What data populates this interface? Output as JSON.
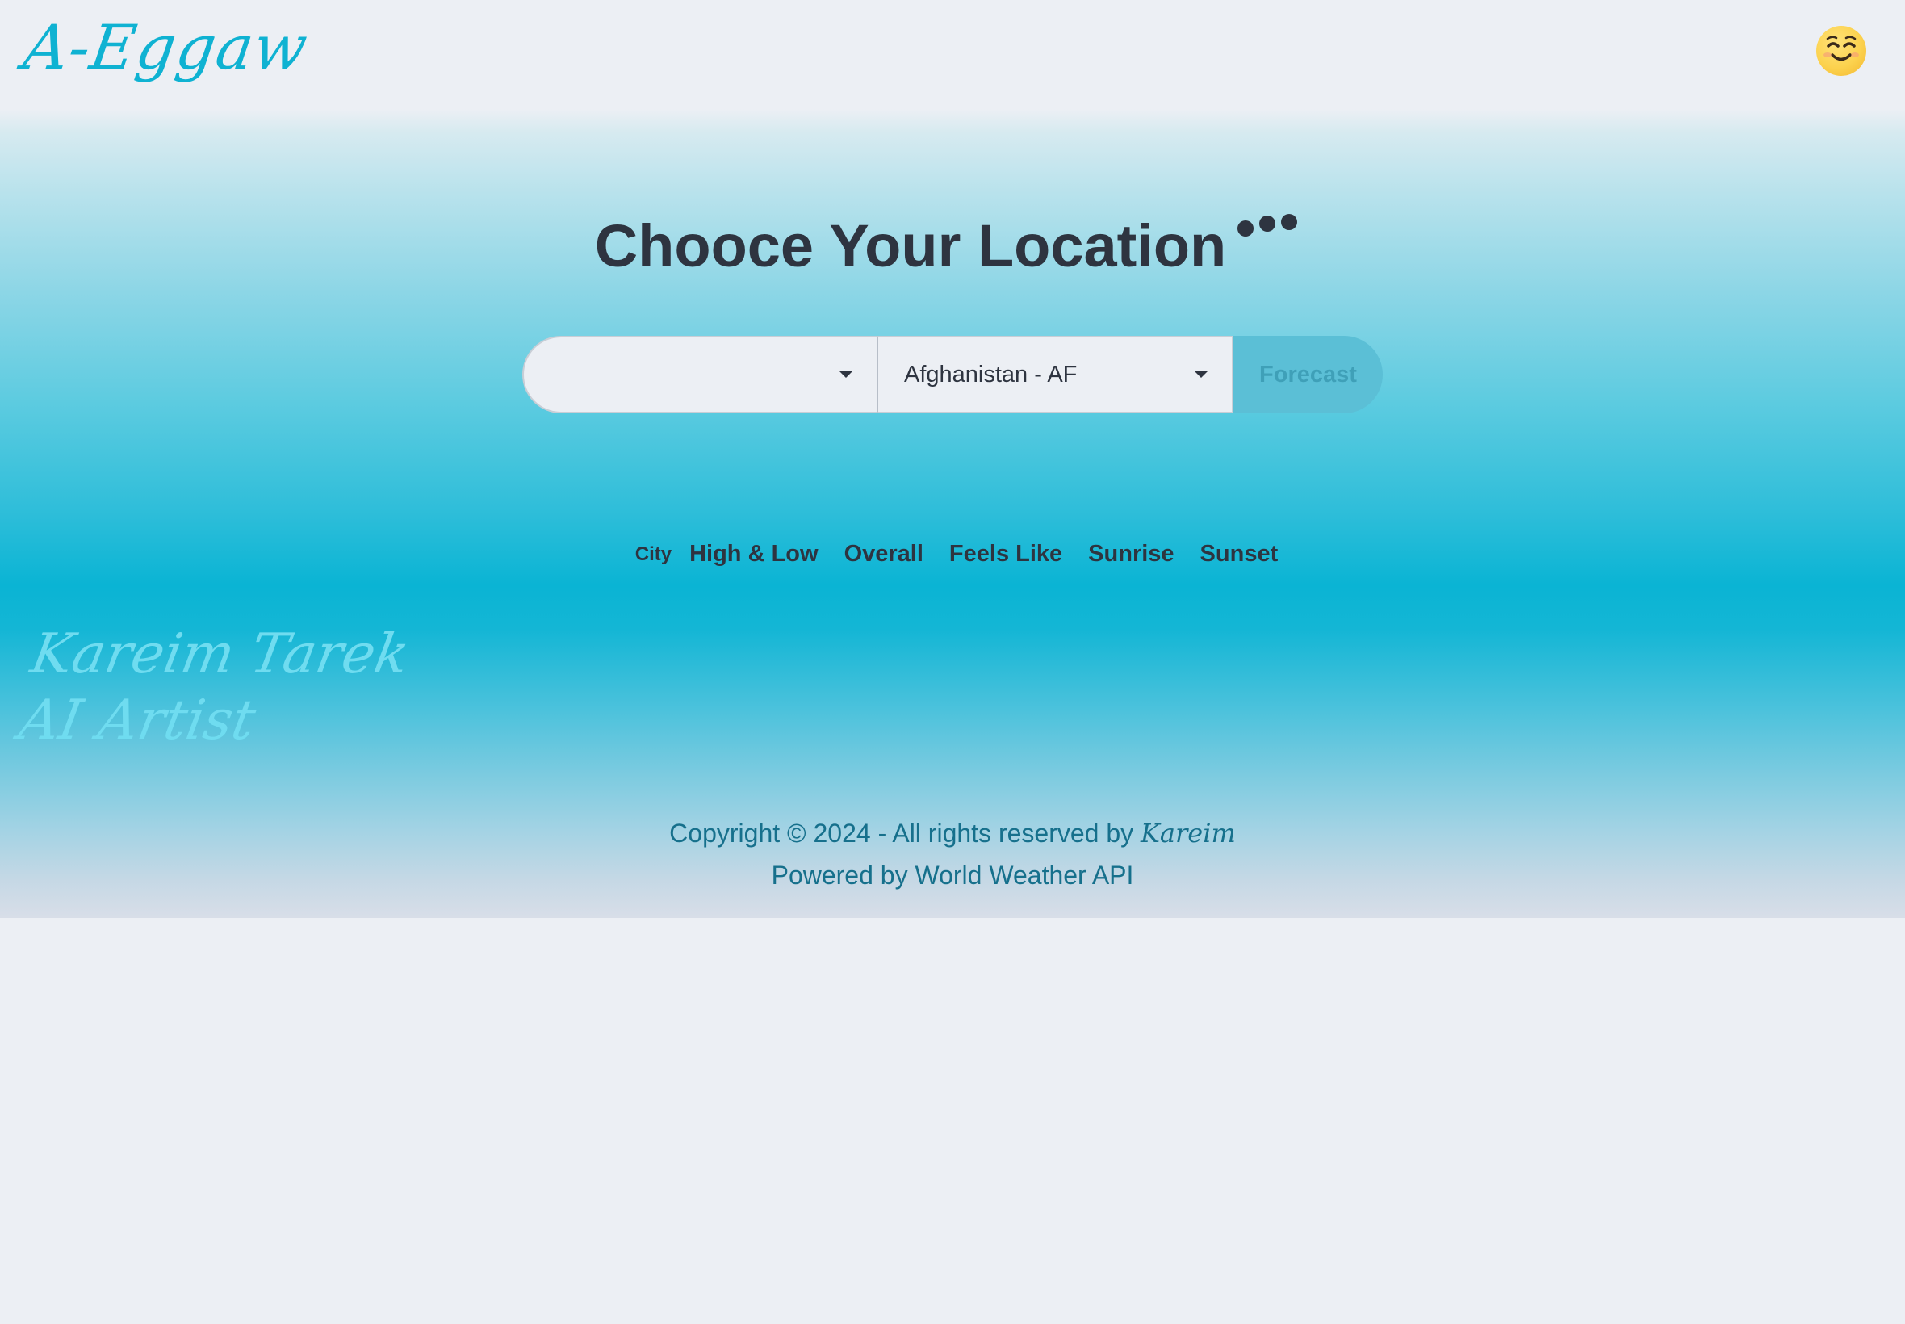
{
  "header": {
    "logo_text": "A-Eggaw",
    "avatar_icon": "smiling-face-icon"
  },
  "main": {
    "title": "Chooce Your Location",
    "title_icon": "dots-icon",
    "city_select": {
      "value": ""
    },
    "country_select": {
      "value": "Afghanistan - AF"
    },
    "forecast_label": "Forecast",
    "tabs": [
      "City",
      "High & Low",
      "Overall",
      "Feels Like",
      "Sunrise",
      "Sunset"
    ]
  },
  "signature": {
    "line1": "Kareim Tarek",
    "line2": "AI Artist"
  },
  "footer": {
    "copyright_prefix": "Copyright © 2024 - All rights reserved by ",
    "copyright_name": "Kareim",
    "powered_by": "Powered by World Weather API"
  },
  "colors": {
    "accent": "#0fb2d2",
    "text": "#2e3440",
    "footer_text": "#16708c",
    "background": "#eceff4"
  }
}
